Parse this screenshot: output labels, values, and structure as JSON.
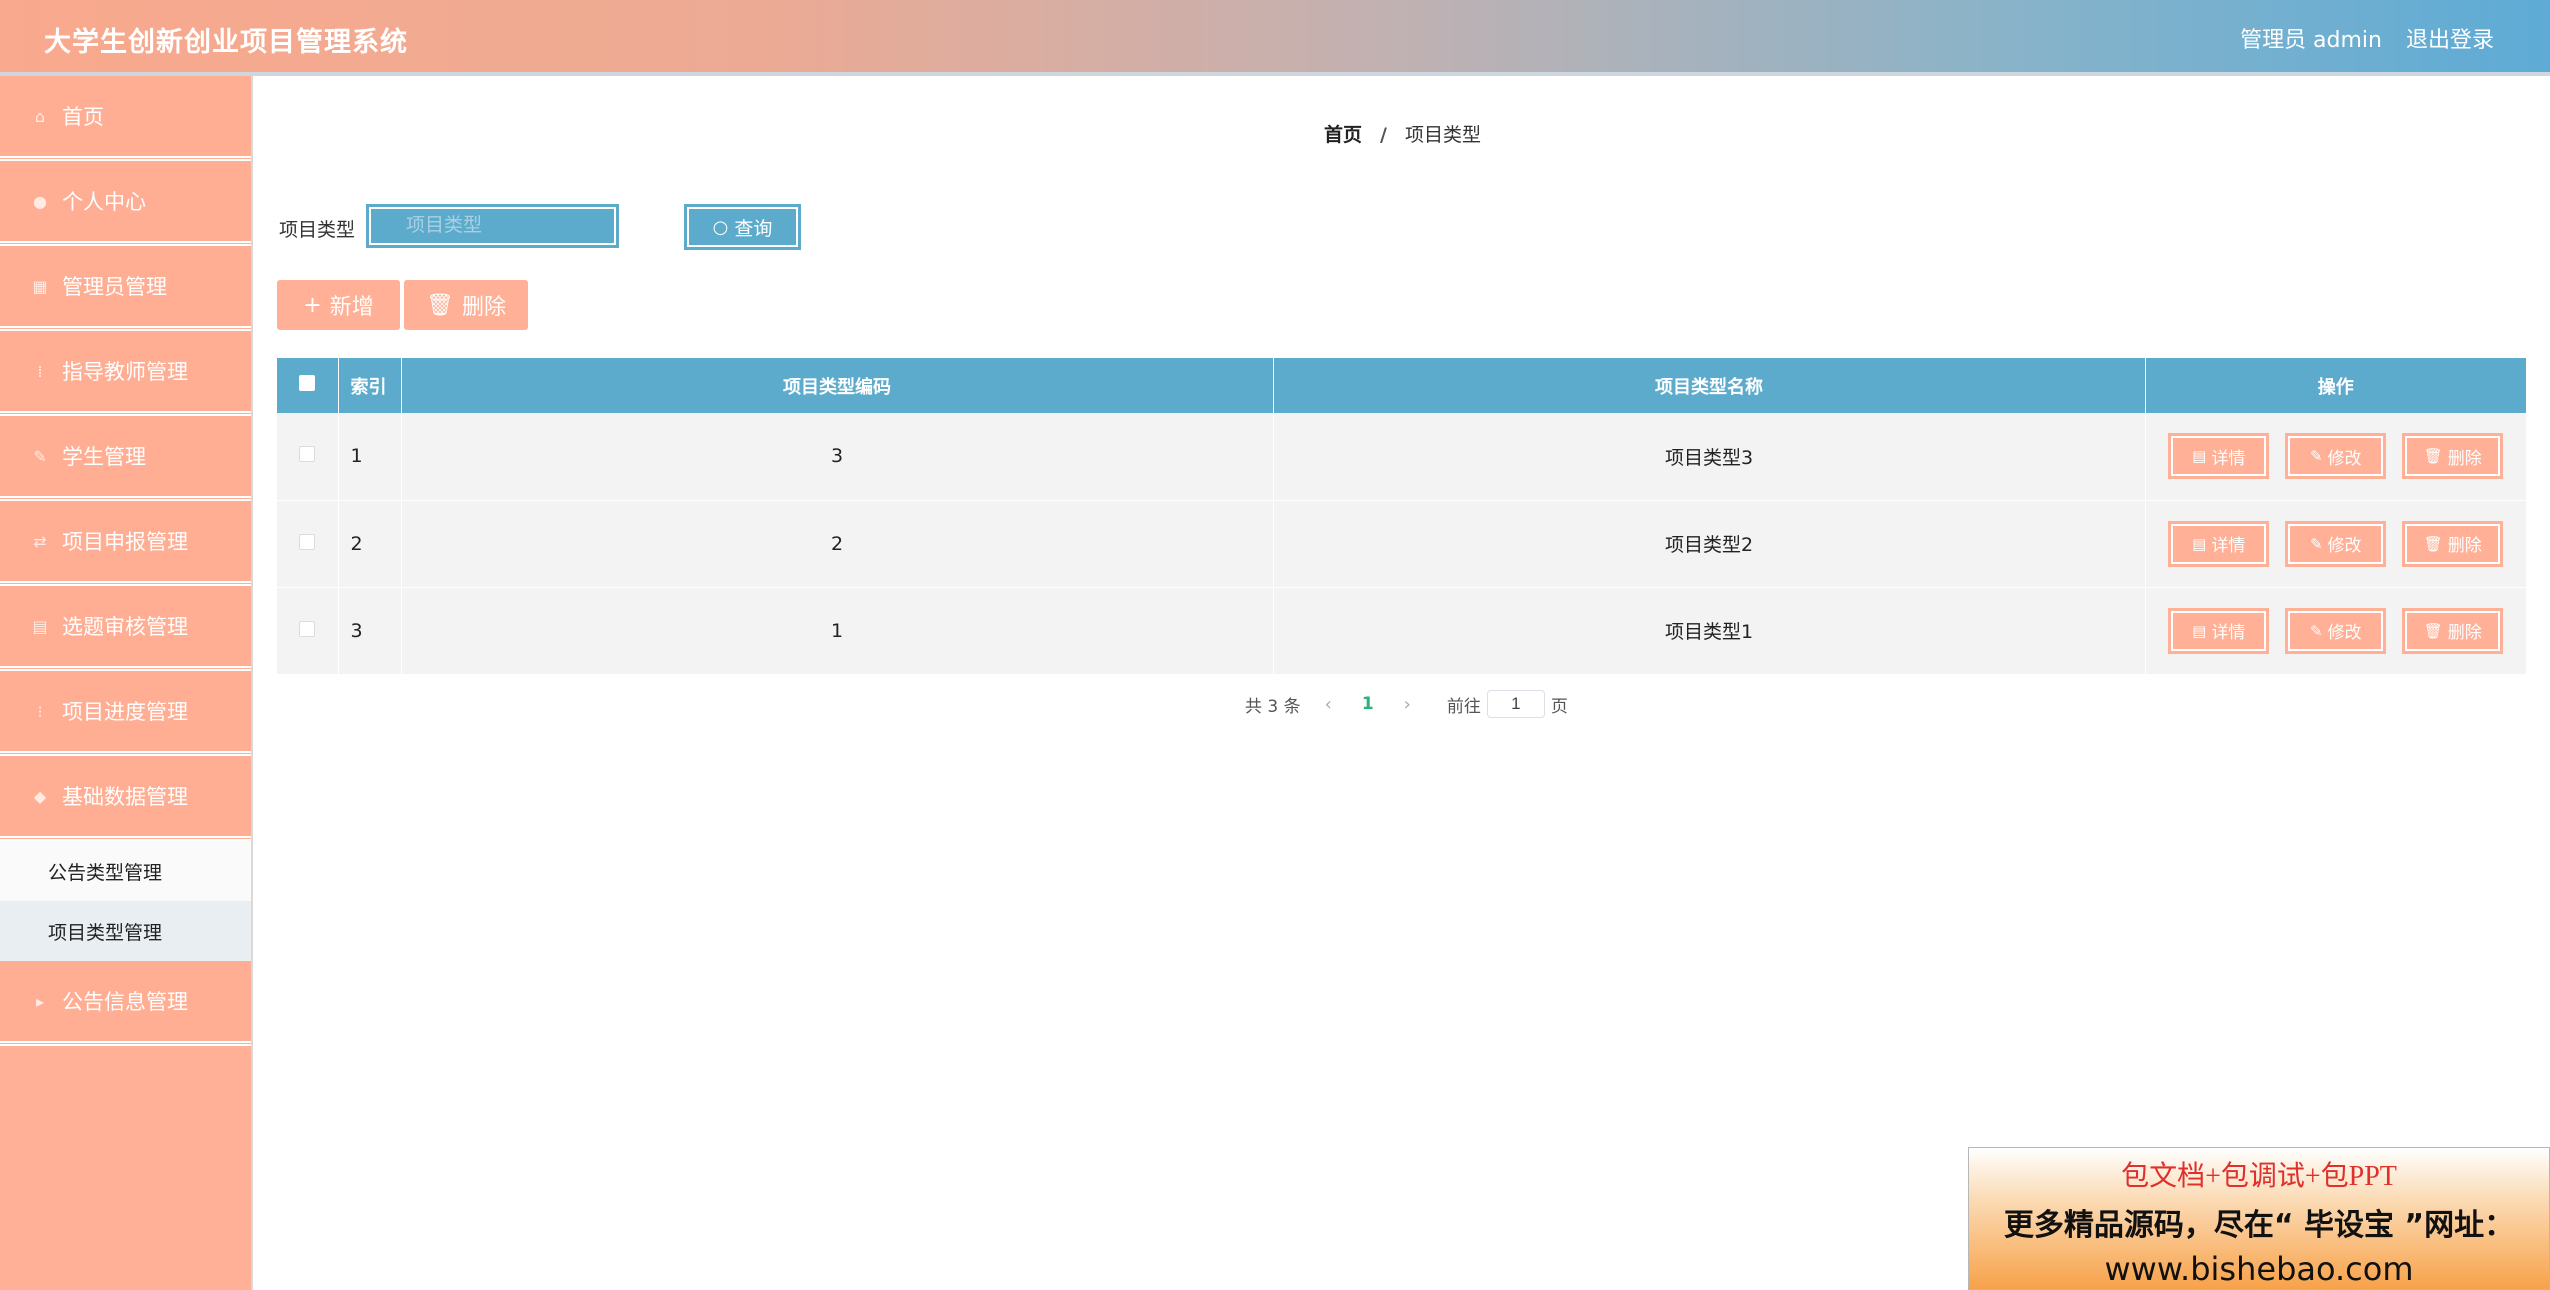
{
  "header": {
    "title": "大学生创新创业项目管理系统",
    "admin_label": "管理员 admin",
    "logout_label": "退出登录"
  },
  "sidebar": {
    "items": [
      {
        "label": "首页",
        "icon": "home-icon"
      },
      {
        "label": "个人中心",
        "icon": "user-icon"
      },
      {
        "label": "管理员管理",
        "icon": "grid-icon"
      },
      {
        "label": "指导教师管理",
        "icon": "teacher-icon"
      },
      {
        "label": "学生管理",
        "icon": "student-icon"
      },
      {
        "label": "项目申报管理",
        "icon": "apply-icon"
      },
      {
        "label": "选题审核管理",
        "icon": "review-icon"
      },
      {
        "label": "项目进度管理",
        "icon": "progress-icon"
      },
      {
        "label": "基础数据管理",
        "icon": "data-icon"
      }
    ],
    "submenu": [
      {
        "label": "公告类型管理"
      },
      {
        "label": "项目类型管理"
      }
    ],
    "bottom_item": {
      "label": "公告信息管理",
      "icon": "notice-icon"
    }
  },
  "breadcrumb": {
    "home": "首页",
    "separator": "/",
    "current": "项目类型"
  },
  "search": {
    "label": "项目类型",
    "placeholder": "项目类型",
    "value": "",
    "query_label": "查询"
  },
  "toolbar": {
    "add_label": "新增",
    "delete_label": "删除"
  },
  "table": {
    "headers": {
      "index": "索引",
      "code": "项目类型编码",
      "name": "项目类型名称",
      "ops": "操作"
    },
    "rows": [
      {
        "index": "1",
        "code": "3",
        "name": "项目类型3"
      },
      {
        "index": "2",
        "code": "2",
        "name": "项目类型2"
      },
      {
        "index": "3",
        "code": "1",
        "name": "项目类型1"
      }
    ],
    "op_labels": {
      "detail": "详情",
      "edit": "修改",
      "delete": "删除"
    }
  },
  "pagination": {
    "total": "共 3 条",
    "current_page": "1",
    "goto_label": "前往",
    "goto_value": "1",
    "page_suffix": "页"
  },
  "watermark": {
    "line1": "包文档+包调试+包PPT",
    "line2": "更多精品源码，尽在“ 毕设宝 ”网址：",
    "line3": "www.bishebao.com"
  },
  "colors": {
    "accent_blue": "#5cabcd",
    "accent_peach": "#ffb096",
    "page_active": "#2ab27b"
  }
}
